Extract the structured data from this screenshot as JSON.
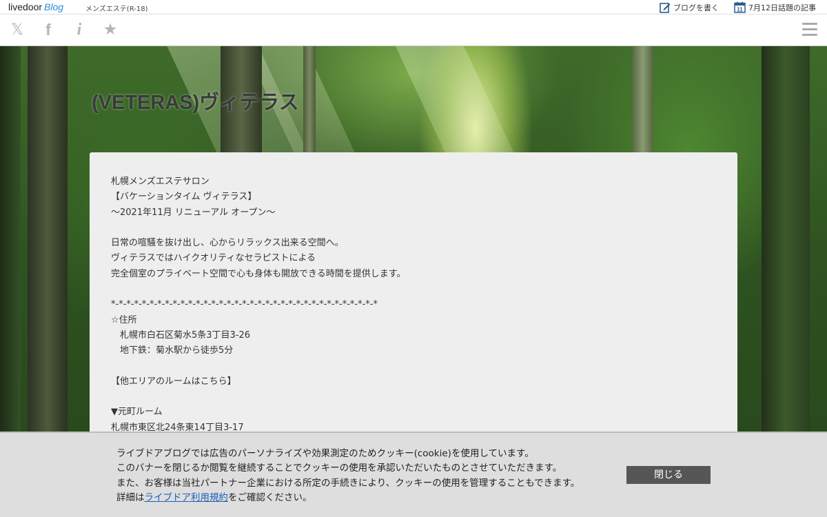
{
  "header": {
    "logo_main": "livedoor",
    "logo_sub": "Blog",
    "blog_category": "メンズエステ(R-18)",
    "write_blog_label": "ブログを書く",
    "calendar_day": "11",
    "topic_label": "7月12日話題の記事"
  },
  "share_bar": {
    "icons": [
      "x-icon",
      "facebook-icon",
      "info-icon",
      "star-icon"
    ],
    "x_glyph": "𝕏",
    "facebook_glyph": "f",
    "info_glyph": "i",
    "star_glyph": "★",
    "menu": "hamburger-menu-icon"
  },
  "blog": {
    "title": "(VETERAS)ヴィテラス",
    "intro_lines": [
      "札幌メンズエステサロン",
      "【バケーションタイム ヴィテラス】",
      "～2021年11月 リニューアル オープン～",
      "",
      "日常の喧騒を抜け出し、心からリラックス出来る空間へ。",
      "ヴィテラスではハイクオリティなセラピストによる",
      "完全個室のプライベート空間で心も身体も開放できる時間を提供します。",
      "",
      "*-*-*-*-*-*-*-*-*-*-*-*-*-*-*-*-*-*-*-*-*-*-*-*-*-*-*-*-*-*-*-*-*-*-*",
      "☆住所",
      "　札幌市白石区菊水5条3丁目3-26",
      "　地下鉄：菊水駅から徒歩5分",
      "",
      "【他エリアのルームはこちら】",
      "",
      "▼元町ルーム",
      "札幌市東区北24条東14丁目3-17"
    ]
  },
  "cookie_banner": {
    "line1": "ライブドアブログでは広告のパーソナライズや効果測定のためクッキー(cookie)を使用しています。",
    "line2": "このバナーを閉じるか閲覧を継続することでクッキーの使用を承認いただいたものとさせていただきます。",
    "line3": "また、お客様は当社パートナー企業における所定の手続きにより、クッキーの使用を管理することもできます。",
    "line4_prefix": "詳細は",
    "line4_link": "ライブドア利用規約",
    "line4_suffix": "をご確認ください。",
    "close_label": "閉じる"
  },
  "colors": {
    "accent_blue": "#2a8fd9",
    "link_blue": "#1a5fb4",
    "panel_bg": "#eeeeee",
    "cookie_bg": "#dedede",
    "close_button_bg": "#565656"
  }
}
